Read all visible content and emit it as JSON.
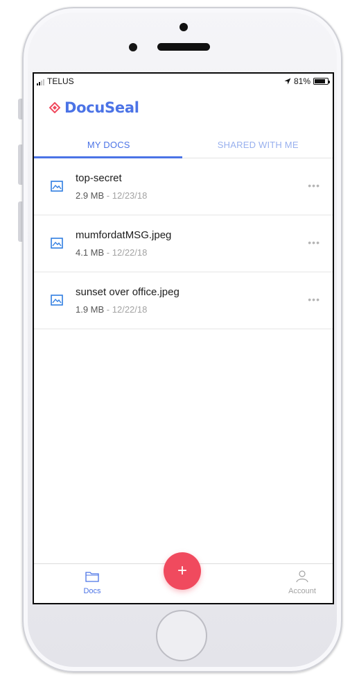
{
  "status_bar": {
    "carrier": "TELUS",
    "battery_percent": "81%",
    "battery_level": 0.81
  },
  "app": {
    "name": "DocuSeal",
    "brand_color": "#4b73e6",
    "accent_color": "#f04a5e"
  },
  "tabs": [
    {
      "label": "MY DOCS",
      "active": true
    },
    {
      "label": "SHARED WITH ME",
      "active": false
    }
  ],
  "files": [
    {
      "name": "top-secret",
      "size": "2.9 MB",
      "separator": " - ",
      "date": "12/23/18",
      "icon": "image-icon",
      "menu_icon": "more-icon"
    },
    {
      "name": "mumfordatMSG.jpeg",
      "size": "4.1 MB",
      "separator": " - ",
      "date": "12/22/18",
      "icon": "image-icon",
      "menu_icon": "more-icon"
    },
    {
      "name": "sunset over office.jpeg",
      "size": "1.9 MB",
      "separator": " - ",
      "date": "12/22/18",
      "icon": "image-icon",
      "menu_icon": "more-icon"
    }
  ],
  "fab": {
    "label": "+",
    "icon": "add-icon"
  },
  "bottom_nav": [
    {
      "label": "Docs",
      "icon": "folder-icon",
      "active": true
    },
    {
      "label": "Account",
      "icon": "user-icon",
      "active": false
    }
  ]
}
